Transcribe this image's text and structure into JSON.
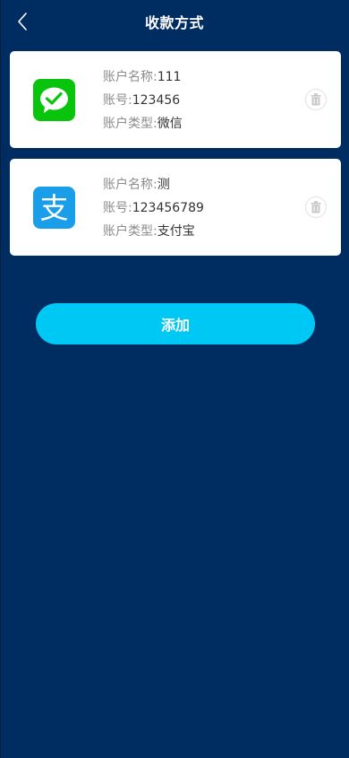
{
  "header": {
    "title": "收款方式",
    "back_icon": "chevron-left-icon"
  },
  "accounts": [
    {
      "type": "wechat",
      "icon": "wechat-icon",
      "icon_color": "#09c40d",
      "name_label": "账户名称:",
      "name_value": "111",
      "number_label": "账号:",
      "number_value": "123456",
      "type_label": "账户类型:",
      "type_value": "微信"
    },
    {
      "type": "alipay",
      "icon": "alipay-icon",
      "icon_color": "#1a9eea",
      "name_label": "账户名称:",
      "name_value": "测",
      "number_label": "账号:",
      "number_value": "123456789",
      "type_label": "账户类型:",
      "type_value": "支付宝"
    }
  ],
  "actions": {
    "add_label": "添加"
  },
  "colors": {
    "background": "#002d61",
    "accent": "#00c8f5",
    "card": "#ffffff"
  }
}
